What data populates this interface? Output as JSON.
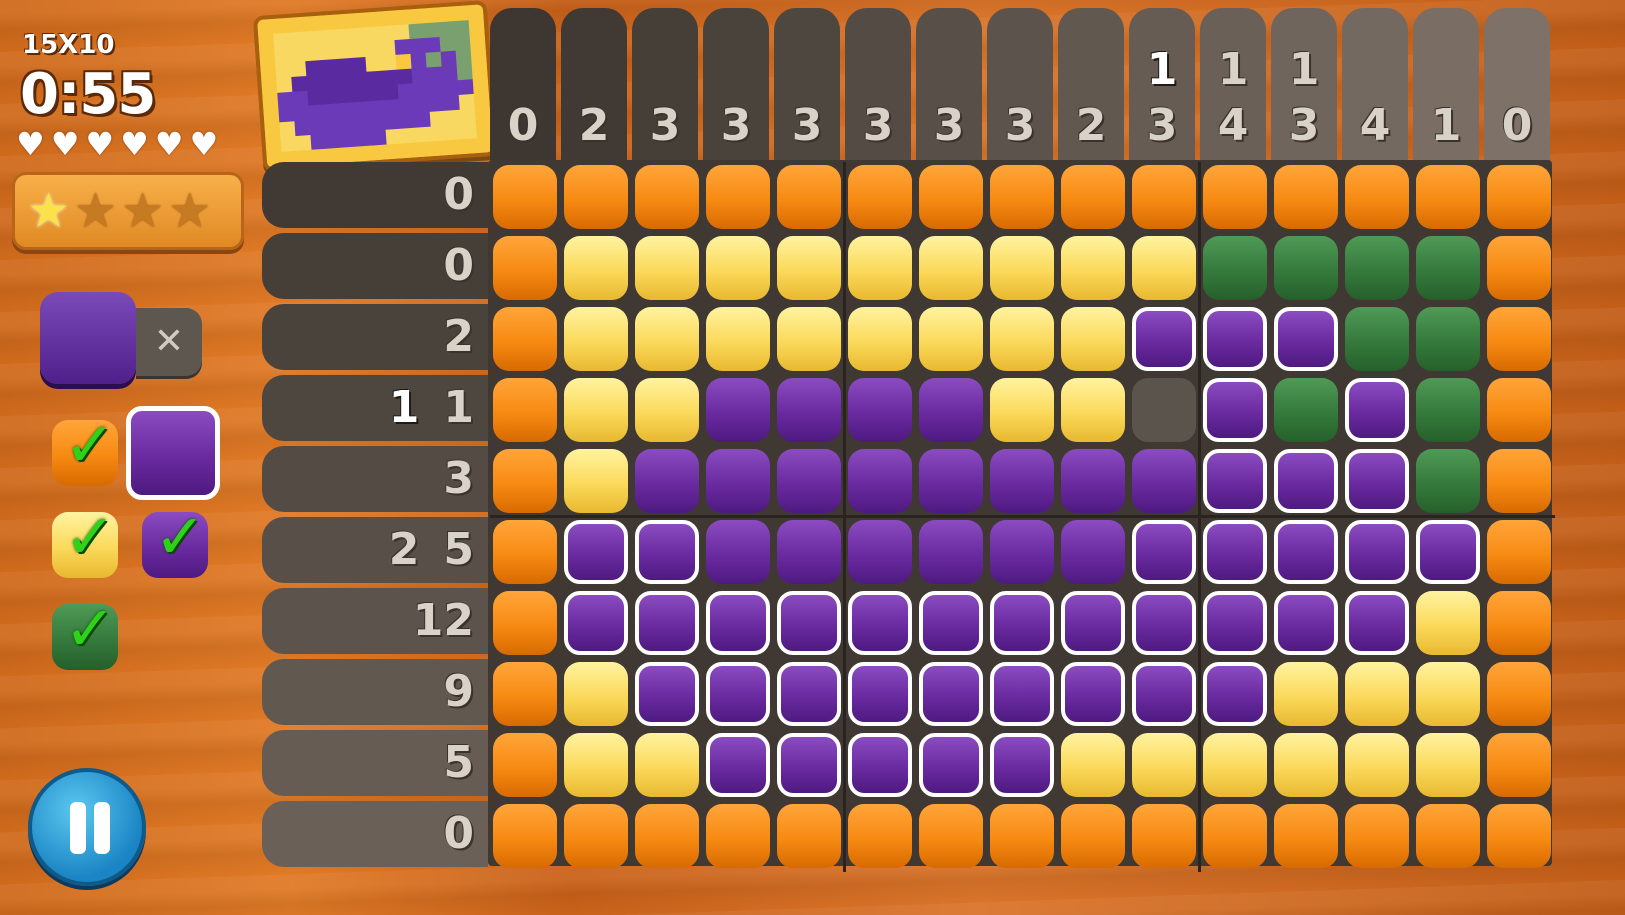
{
  "hud": {
    "size_label": "15X10",
    "timer": "0:55",
    "hearts": 6,
    "stars_total": 4,
    "stars_earned": 1
  },
  "palette": {
    "current": "purple",
    "clear_symbol": "✕",
    "check_symbol": "✓",
    "colors": {
      "orange": "#f78a12",
      "yellow": "#fbd95a",
      "green": "#357a3c",
      "purple": "#6a2aa0"
    }
  },
  "column_clues": [
    [
      "0"
    ],
    [
      "2"
    ],
    [
      "3"
    ],
    [
      "3"
    ],
    [
      "3"
    ],
    [
      "3"
    ],
    [
      "3"
    ],
    [
      "3"
    ],
    [
      "2"
    ],
    [
      "1",
      "3"
    ],
    [
      "1",
      "4"
    ],
    [
      "1",
      "3"
    ],
    [
      "4"
    ],
    [
      "1"
    ],
    [
      "0"
    ]
  ],
  "column_clue_white_top": [
    false,
    false,
    false,
    false,
    false,
    false,
    false,
    false,
    false,
    true,
    false,
    false,
    false,
    false,
    false
  ],
  "row_clues": [
    [
      "0"
    ],
    [
      "0"
    ],
    [
      "2"
    ],
    [
      "1",
      "1"
    ],
    [
      "3"
    ],
    [
      "2",
      "5"
    ],
    [
      "12"
    ],
    [
      "9"
    ],
    [
      "5"
    ],
    [
      "0"
    ]
  ],
  "row_clue_white_first": [
    false,
    false,
    false,
    true,
    false,
    false,
    false,
    false,
    false,
    false
  ],
  "grid": [
    "ooooooooooooooo",
    "oyyyyyyyyyggggo",
    "oyyyyyyyyPPPggo",
    "oyyppppyyePgPgo",
    "oyppppppppPPPgo",
    "oPPppppppPPPPPo",
    "oPPPPPPPPPPPPyo",
    "oyPPPPPPPPPyyyo",
    "oyyPPPPPyyyyyyo",
    "ooooooooooooooo"
  ],
  "grid_note": "o=orange y=yellow g=green p=purple P=purple-highlighted e=empty"
}
